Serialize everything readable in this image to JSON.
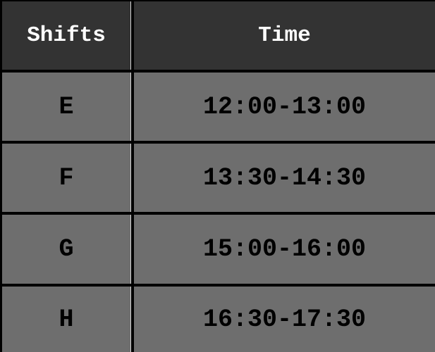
{
  "table": {
    "headers": [
      "Shifts",
      "Time"
    ],
    "rows": [
      [
        "E",
        "12:00-13:00"
      ],
      [
        "F",
        "13:30-14:30"
      ],
      [
        "G",
        "15:00-16:00"
      ],
      [
        "H",
        "16:30-17:30"
      ]
    ]
  },
  "colors": {
    "header_bg": "#333333",
    "header_text": "#ffffff",
    "cell_bg": "#6e6e6e",
    "cell_text": "#000000",
    "border": "#000000"
  }
}
